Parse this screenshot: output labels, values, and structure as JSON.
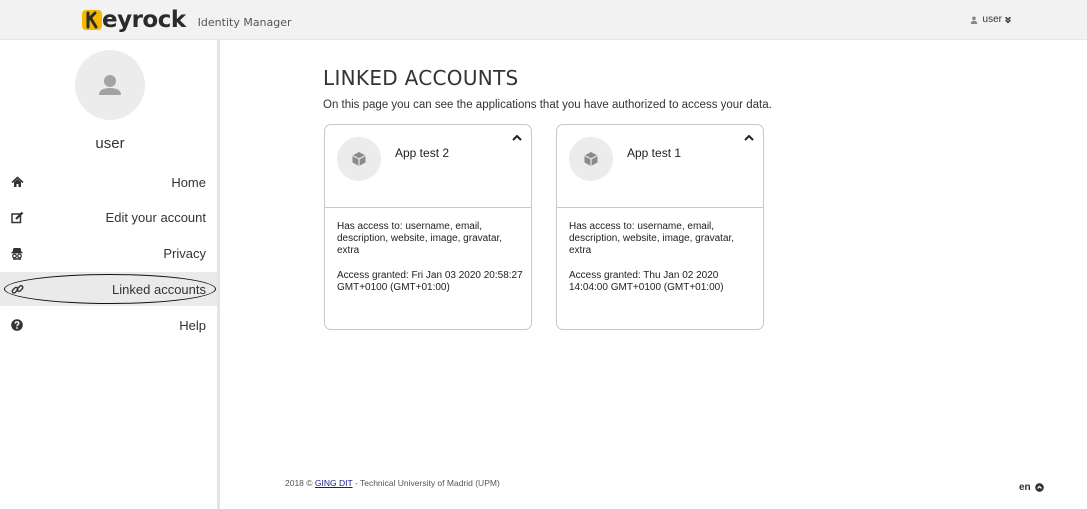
{
  "header": {
    "brand": "eyrock",
    "brand_initial": "K",
    "subtitle": "Identity Manager",
    "user_label": "user",
    "user_caret": "»",
    "brand_color": "#f5b800"
  },
  "sidebar": {
    "username": "user",
    "items": [
      {
        "label": "Home",
        "icon": "home-icon"
      },
      {
        "label": "Edit your account",
        "icon": "edit-icon"
      },
      {
        "label": "Privacy",
        "icon": "incognito-icon"
      },
      {
        "label": "Linked accounts",
        "icon": "link-icon",
        "active": true
      },
      {
        "label": "Help",
        "icon": "help-icon"
      }
    ]
  },
  "main": {
    "title": "LINKED ACCOUNTS",
    "description": "On this page you can see the applications that you have authorized to access your data.",
    "cards": [
      {
        "name": "App test 2",
        "access": "Has access to: username, email, description, website, image, gravatar, extra",
        "granted": "Access granted: Fri Jan 03 2020 20:58:27 GMT+0100 (GMT+01:00)"
      },
      {
        "name": "App test 1",
        "access": "Has access to: username, email, description, website, image, gravatar, extra",
        "granted": "Access granted: Thu Jan 02 2020 14:04:00 GMT+0100 (GMT+01:00)"
      }
    ]
  },
  "footer": {
    "prefix": "2018 ©",
    "link": "GING DIT",
    "suffix": "- Technical University of Madrid (UPM)",
    "language": "en"
  }
}
